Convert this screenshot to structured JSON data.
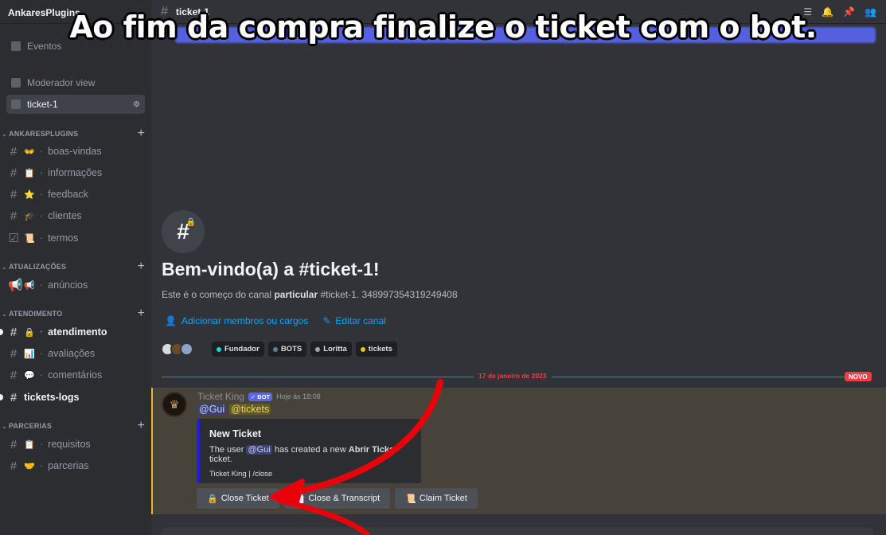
{
  "server": {
    "name": "AnkaresPlugins"
  },
  "top_items": [
    {
      "label": "Eventos"
    },
    {
      "label": "Moderador view"
    },
    {
      "label": "ticket-1"
    }
  ],
  "categories": [
    {
      "name": "ANKARESPLUGINS",
      "channels": [
        {
          "emoji": "👐",
          "name": "boas-vindas"
        },
        {
          "emoji": "📋",
          "name": "informações"
        },
        {
          "emoji": "⭐",
          "name": "feedback"
        },
        {
          "emoji": "🎓",
          "name": "clientes"
        },
        {
          "emoji": "📜",
          "name": "termos"
        }
      ]
    },
    {
      "name": "ATUALIZAÇÕES",
      "channels": [
        {
          "emoji": "📢",
          "name": "anúncios"
        }
      ]
    },
    {
      "name": "ATENDIMENTO",
      "channels": [
        {
          "emoji": "🔒",
          "name": "atendimento"
        },
        {
          "emoji": "📊",
          "name": "avaliações"
        },
        {
          "emoji": "💬",
          "name": "comentários"
        },
        {
          "emoji": "",
          "name": "tickets-logs"
        }
      ]
    },
    {
      "name": "PARCERIAS",
      "channels": [
        {
          "emoji": "📋",
          "name": "requisitos"
        },
        {
          "emoji": "🤝",
          "name": "parcerias"
        }
      ]
    }
  ],
  "header": {
    "channel": "ticket-1"
  },
  "caption": "Ao fim da compra finalize o ticket com o bot.",
  "welcome": {
    "title": "Bem-vindo(a) a #ticket-1!",
    "desc_prefix": "Este é o começo do canal",
    "desc_bold": "particular",
    "desc_suffix": "#ticket-1. 348997354319249408",
    "add_members": "Adicionar membros ou cargos",
    "edit_channel": "Editar canal"
  },
  "roles": [
    {
      "name": "Fundador",
      "color": "#1ad5d5"
    },
    {
      "name": "BOTS",
      "color": "#607d8b"
    },
    {
      "name": "Loritta",
      "color": "#99aab5"
    },
    {
      "name": "tickets",
      "color": "#f1c40f"
    }
  ],
  "divider": {
    "date": "17 de janeiro de 2023",
    "new_label": "NOVO"
  },
  "message": {
    "author": "Ticket King",
    "bot_tag": "BOT",
    "time": "Hoje às 18:08",
    "mention_user": "@Gui",
    "mention_role": "@tickets",
    "embed": {
      "title": "New Ticket",
      "desc_1": "The user",
      "mention": "@Gui",
      "desc_2": "has created a new",
      "desc_bold": "Abrir Ticket",
      "desc_3": "ticket.",
      "footer": "Ticket King | /close"
    },
    "buttons": [
      {
        "icon": "🔒",
        "label": "Close Ticket"
      },
      {
        "icon": "📄",
        "label": "Close & Transcript"
      },
      {
        "icon": "📜",
        "label": "Claim Ticket"
      }
    ]
  },
  "colors": {
    "accent": "#5865f2",
    "link": "#00a8fc",
    "danger": "#f23f43",
    "highlight": "#48433a",
    "arrow": "#e8000a"
  }
}
